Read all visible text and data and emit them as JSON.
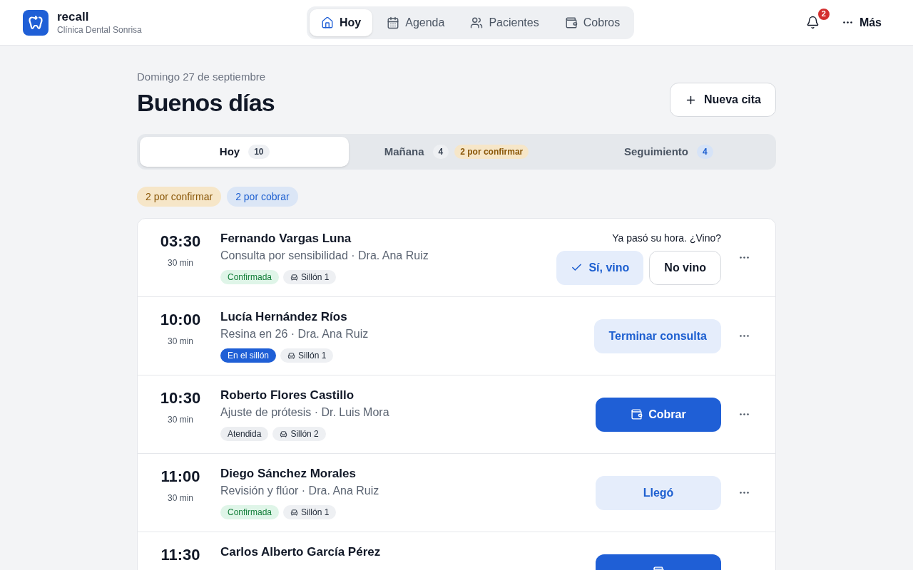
{
  "header": {
    "brand": "recall",
    "clinic": "Clínica Dental Sonrisa",
    "nav": [
      {
        "label": "Hoy",
        "selected": true
      },
      {
        "label": "Agenda",
        "selected": false
      },
      {
        "label": "Pacientes",
        "selected": false
      },
      {
        "label": "Cobros",
        "selected": false
      }
    ],
    "notification_count": "2",
    "more": "Más"
  },
  "date": "Domingo 27 de septiembre",
  "greeting": "Buenos días",
  "new_appointment": "Nueva cita",
  "day_tabs": [
    {
      "label": "Hoy",
      "selected": true,
      "badges": [
        {
          "text": "10",
          "kind": "neutral"
        }
      ]
    },
    {
      "label": "Mañana",
      "selected": false,
      "badges": [
        {
          "text": "4",
          "kind": "neutral"
        },
        {
          "text": "2 por confirmar",
          "kind": "warning"
        }
      ]
    },
    {
      "label": "Seguimiento",
      "selected": false,
      "badges": [
        {
          "text": "4",
          "kind": "info"
        }
      ]
    }
  ],
  "filters": [
    {
      "label": "2 por confirmar",
      "kind": "warning"
    },
    {
      "label": "2 por cobrar",
      "kind": "info"
    }
  ],
  "appointments": [
    {
      "time": "03:30",
      "duration": "30 min",
      "patient": "Fernando Vargas Luna",
      "detail": "Consulta por sensibilidad · Dra. Ana Ruiz",
      "status": {
        "label": "Confirmada",
        "kind": "confirmed"
      },
      "chair": "Sillón 1",
      "prompt": "Ya pasó su hora. ¿Vino?",
      "actions": [
        {
          "label": "Sí, vino",
          "kind": "confirm"
        },
        {
          "label": "No vino",
          "kind": "outline"
        }
      ]
    },
    {
      "time": "10:00",
      "duration": "30 min",
      "patient": "Lucía Hernández Ríos",
      "detail": "Resina en 26 · Dra. Ana Ruiz",
      "status": {
        "label": "En el sillón",
        "kind": "in_chair"
      },
      "chair": "Sillón 1",
      "actions": [
        {
          "label": "Terminar consulta",
          "kind": "soft"
        }
      ]
    },
    {
      "time": "10:30",
      "duration": "30 min",
      "patient": "Roberto Flores Castillo",
      "detail": "Ajuste de prótesis · Dr. Luis Mora",
      "status": {
        "label": "Atendida",
        "kind": "done"
      },
      "chair": "Sillón 2",
      "actions": [
        {
          "label": "Cobrar",
          "kind": "pay"
        }
      ]
    },
    {
      "time": "11:00",
      "duration": "30 min",
      "patient": "Diego Sánchez Morales",
      "detail": "Revisión y flúor · Dra. Ana Ruiz",
      "status": {
        "label": "Confirmada",
        "kind": "confirmed"
      },
      "chair": "Sillón 1",
      "actions": [
        {
          "label": "Llegó",
          "kind": "soft"
        }
      ]
    },
    {
      "time": "11:30",
      "patient": "Carlos Alberto García Pérez",
      "actions": [
        {
          "kind": "pay"
        }
      ]
    }
  ]
}
